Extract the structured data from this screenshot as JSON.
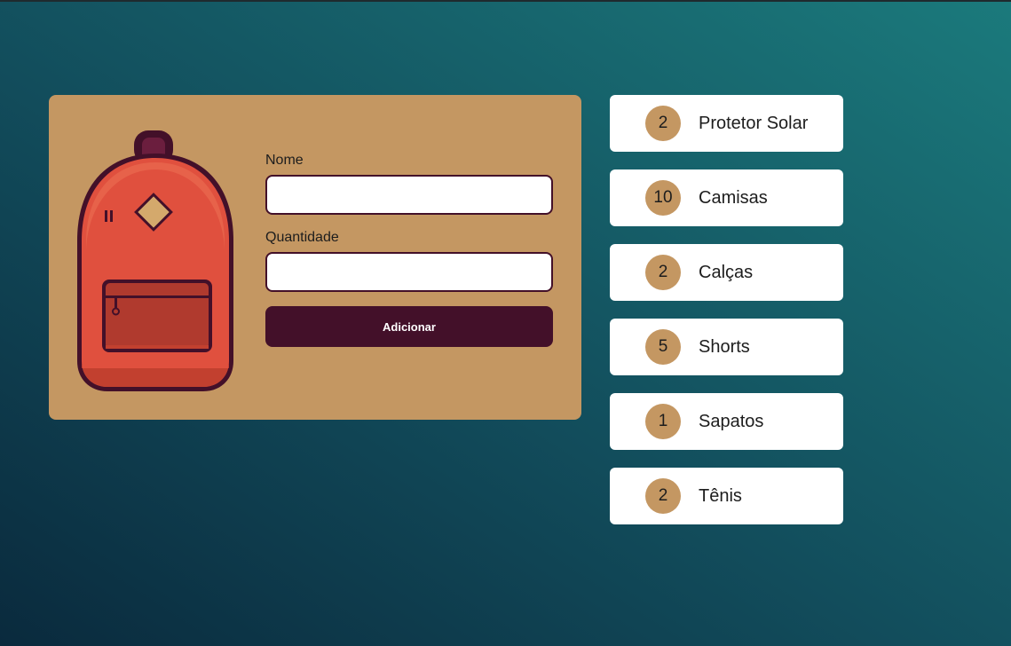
{
  "colors": {
    "background_start": "#0a2a3d",
    "background_end": "#1b7a7c",
    "card": "#c49762",
    "accent": "#431029",
    "backpack_body": "#e0503e",
    "backpack_pocket": "#b03a2e",
    "badge": "#c49762"
  },
  "form": {
    "name_label": "Nome",
    "name_value": "",
    "quantity_label": "Quantidade",
    "quantity_value": "",
    "submit_label": "Adicionar"
  },
  "illustration": {
    "icon": "backpack-icon"
  },
  "items": [
    {
      "quantity": "2",
      "name": "Protetor Solar"
    },
    {
      "quantity": "10",
      "name": "Camisas"
    },
    {
      "quantity": "2",
      "name": "Calças"
    },
    {
      "quantity": "5",
      "name": "Shorts"
    },
    {
      "quantity": "1",
      "name": "Sapatos"
    },
    {
      "quantity": "2",
      "name": "Tênis"
    }
  ]
}
